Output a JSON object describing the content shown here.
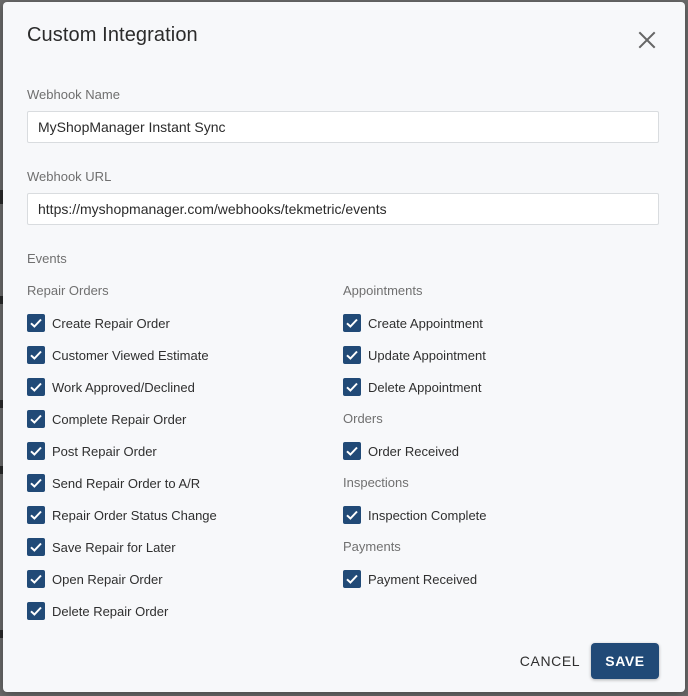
{
  "dialog": {
    "title": "Custom Integration",
    "save_label": "SAVE",
    "cancel_label": "CANCEL"
  },
  "webhook_name": {
    "label": "Webhook Name",
    "value": "MyShopManager Instant Sync"
  },
  "webhook_url": {
    "label": "Webhook URL",
    "value": "https://myshopmanager.com/webhooks/tekmetric/events"
  },
  "events": {
    "label": "Events",
    "repair_orders": {
      "heading": "Repair Orders",
      "items": [
        {
          "label": "Create Repair Order",
          "checked": true
        },
        {
          "label": "Customer Viewed Estimate",
          "checked": true
        },
        {
          "label": "Work Approved/Declined",
          "checked": true
        },
        {
          "label": "Complete Repair Order",
          "checked": true
        },
        {
          "label": "Post Repair Order",
          "checked": true
        },
        {
          "label": "Send Repair Order to A/R",
          "checked": true
        },
        {
          "label": "Repair Order Status Change",
          "checked": true
        },
        {
          "label": "Save Repair for Later",
          "checked": true
        },
        {
          "label": "Open Repair Order",
          "checked": true
        },
        {
          "label": "Delete Repair Order",
          "checked": true
        }
      ]
    },
    "appointments": {
      "heading": "Appointments",
      "items": [
        {
          "label": "Create Appointment",
          "checked": true
        },
        {
          "label": "Update Appointment",
          "checked": true
        },
        {
          "label": "Delete Appointment",
          "checked": true
        }
      ]
    },
    "orders": {
      "heading": "Orders",
      "items": [
        {
          "label": "Order Received",
          "checked": true
        }
      ]
    },
    "inspections": {
      "heading": "Inspections",
      "items": [
        {
          "label": "Inspection Complete",
          "checked": true
        }
      ]
    },
    "payments": {
      "heading": "Payments",
      "items": [
        {
          "label": "Payment Received",
          "checked": true
        }
      ]
    }
  },
  "colors": {
    "accent": "#214a77",
    "dialog_bg": "#f7f8fa"
  }
}
